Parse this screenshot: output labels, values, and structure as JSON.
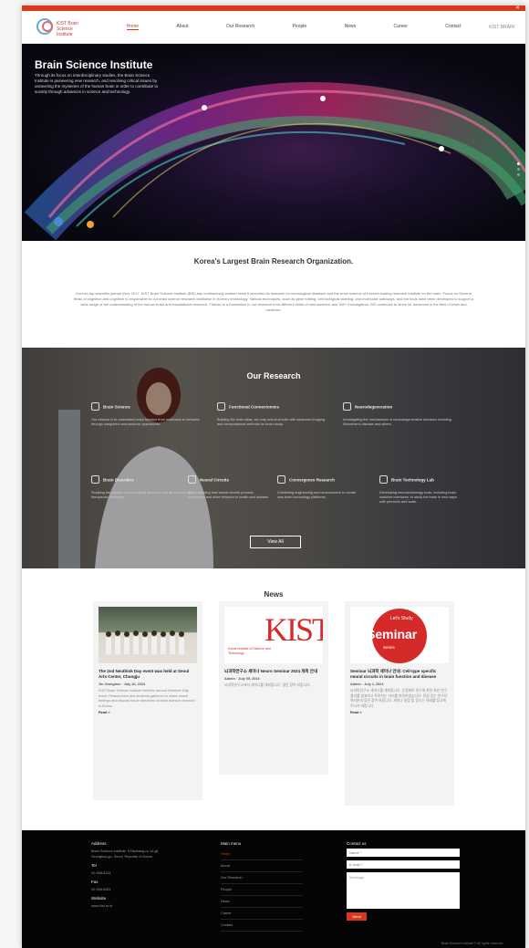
{
  "nav": {
    "logo_text": "KIST Brain Science Institute",
    "items": [
      "Home",
      "About",
      "Our Research",
      "People",
      "News",
      "Career",
      "Contact"
    ],
    "right_label": "KIST BRAIN"
  },
  "hero": {
    "title": "Brain Science Institute",
    "description": "Through its focus on interdisciplinary studies, the Brain Science Institute is pioneering new research, and resolving critical issues by unraveling the mysteries of the human brain in order to contribute to society through advances in science and technology."
  },
  "intro": {
    "heading": "Korea's Largest Brain Research Organization.",
    "body": "Korea's top scientific journal (Nov 2017, KIST Brain Science Institute (BSI) has continuously worked since it launched its research on neurological diseases and the brain science of Korea's leading research institute on the brain. Focus on Several fields of cognitive and cognitive is responsible to our brain science research institution in Korea's technology. Various techniques, such as gene editing, cell biological labeling, and molecular pathways, and the tools have been developed to support a wide range of the understanding of the human brain and translational research. Thanks to a foundation to our research from different fields of neuroscience and 300+ investigators, BSI continues to strive for advances in the field of brain and medicine."
  },
  "research": {
    "heading": "Our Research",
    "items": [
      {
        "title": "Brain Science",
        "desc": "Our mission is to understand brain function from molecules to behavior through integrated neuroscience approaches."
      },
      {
        "title": "Functional Connectomics",
        "desc": "Building the brain atlas, we map neural circuits with advanced imaging and computational methods for brain study."
      },
      {
        "title": "Neurodegeneration",
        "desc": "Investigating the mechanisms of neurodegenerative diseases including Alzheimer's disease and others."
      },
      {
        "title": "Brain Disorders",
        "desc": "Studying the causes of neurological disorders and developing new therapeutic strategies."
      },
      {
        "title": "Neural Circuits",
        "desc": "Understanding how neural circuits process information and drive behavior in health and disease."
      },
      {
        "title": "Convergence Research",
        "desc": "Combining engineering and neuroscience to create new brain technology platforms."
      },
      {
        "title": "Brain Technology Lab",
        "desc": "Developing neurotechnology tools, including brain-machine interfaces, to study the brain in new ways with precision and scale."
      }
    ],
    "button_label": "View All"
  },
  "news": {
    "heading": "News",
    "cards": [
      {
        "title": "The 2nd Neuthink Day event was held at Seoul Arts Center, Chungju",
        "meta": "Jin Jeonghee · July 10, 2024",
        "excerpt": "KIST Brain Science Institute held the second Neuthink Day event. Researchers and students gathered to share recent findings and discuss future directions of brain science research in Korea...",
        "more": "Read >"
      },
      {
        "title": "뇌과학연구소 세미나 Neuro Seminar 2024 개최 안내",
        "meta": "Admin · July 05, 2024",
        "excerpt": "뇌과학연구소에서 세미나를 개최합니다. 많은 참여 바랍니다.",
        "logo_text": "KIST",
        "logo_caption": "Korea Institute of Science and Technology"
      },
      {
        "title": "Seminar 뇌과학 세미나 안내: Cell-type specific neural circuits in brain function and disease",
        "meta": "Admin · July 1, 2024",
        "excerpt": "뇌과학연구소 세미나를 개최합니다. 신경회로 연구에 관한 최신 연구 결과를 발표하고 토론하는 자리를 마련하였습니다. 관심 있는 연구자 여러분의 많은 참여 바랍니다. 세미나 일정 및 장소는 아래를 참고해 주시기 바랍니다.",
        "more": "Read >",
        "badge_top": "Let's Study",
        "badge_main": "Seminar",
        "badge_sub": "Series"
      }
    ]
  },
  "footer": {
    "address_heading": "Address",
    "address": "Brain Science Institute, 5 Hwarang-ro 14-gil, Seongbuk-gu, Seoul, Republic of Korea",
    "tel_label": "Tel",
    "tel": "02-958-6114",
    "fax_label": "Fax",
    "fax": "02-958-6051",
    "website_label": "Website",
    "website": "www.kist.re.kr",
    "menu_heading": "Main menu",
    "menu": [
      "Home",
      "About",
      "Our Research",
      "People",
      "News",
      "Career",
      "Contact"
    ],
    "contact_heading": "Contact us",
    "name_placeholder": "Name *",
    "email_placeholder": "E-mail *",
    "message_placeholder": "Message",
    "send_label": "Send",
    "copyright": "Brain Science Institute © All rights reserved."
  },
  "colors": {
    "accent": "#d9381e",
    "footer_bg": "#050505"
  }
}
